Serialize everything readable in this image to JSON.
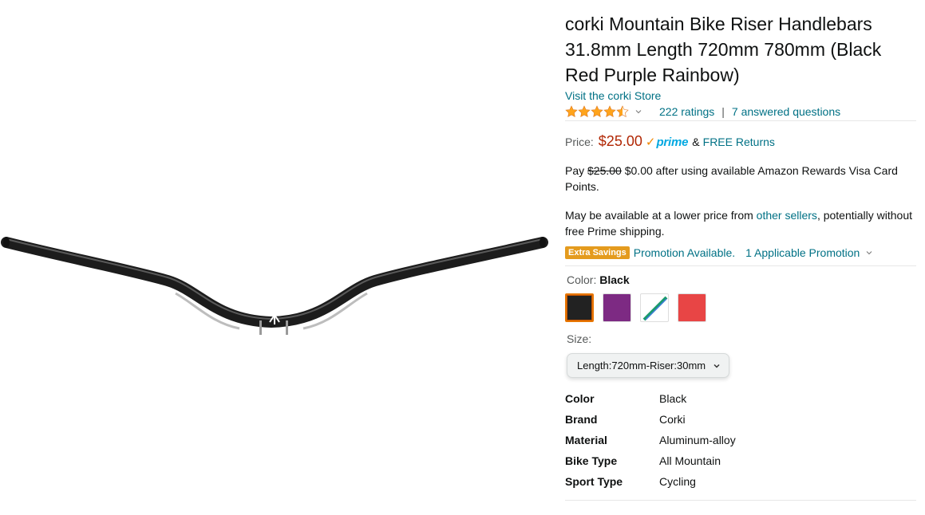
{
  "product": {
    "title": "corki Mountain Bike Riser Handlebars 31.8mm Length 720mm 780mm (Black Red Purple Rainbow)",
    "store_link": "Visit the corki Store",
    "rating_value": 4.5,
    "ratings_count": "222 ratings",
    "separator": "|",
    "answered_questions": "7 answered questions",
    "product_image_icon": "handlebar-image"
  },
  "price": {
    "label": "Price:",
    "value": "$25.00",
    "prime_check": "✓",
    "prime_word": "prime",
    "amp": "&",
    "free_returns": "FREE Returns"
  },
  "rewards": {
    "pay": "Pay",
    "old_price": "$25.00",
    "rest": "$0.00 after using available Amazon Rewards Visa Card Points."
  },
  "lower_price": {
    "before": "May be available at a lower price from",
    "link": "other sellers",
    "after": ", potentially without free Prime shipping."
  },
  "promotion": {
    "badge": "Extra Savings",
    "text": "Promotion Available.",
    "link": "1 Applicable Promotion"
  },
  "color": {
    "label": "Color:",
    "selected": "Black",
    "swatches": [
      {
        "name": "Black",
        "color": "#222222"
      },
      {
        "name": "Purple",
        "color": "#7d2a83"
      },
      {
        "name": "Rainbow",
        "color": "#1a9a6c"
      },
      {
        "name": "Red",
        "color": "#e84545"
      }
    ]
  },
  "size": {
    "label": "Size:",
    "selected": "Length:720mm-Riser:30mm"
  },
  "specs": [
    {
      "key": "Color",
      "value": "Black"
    },
    {
      "key": "Brand",
      "value": "Corki"
    },
    {
      "key": "Material",
      "value": "Aluminum-alloy"
    },
    {
      "key": "Bike Type",
      "value": "All Mountain"
    },
    {
      "key": "Sport Type",
      "value": "Cycling"
    }
  ],
  "colors": {
    "link": "#007185",
    "price": "#b12704",
    "badge": "#e49b1e",
    "star": "#ffa41c",
    "prime": "#00a8e1"
  }
}
